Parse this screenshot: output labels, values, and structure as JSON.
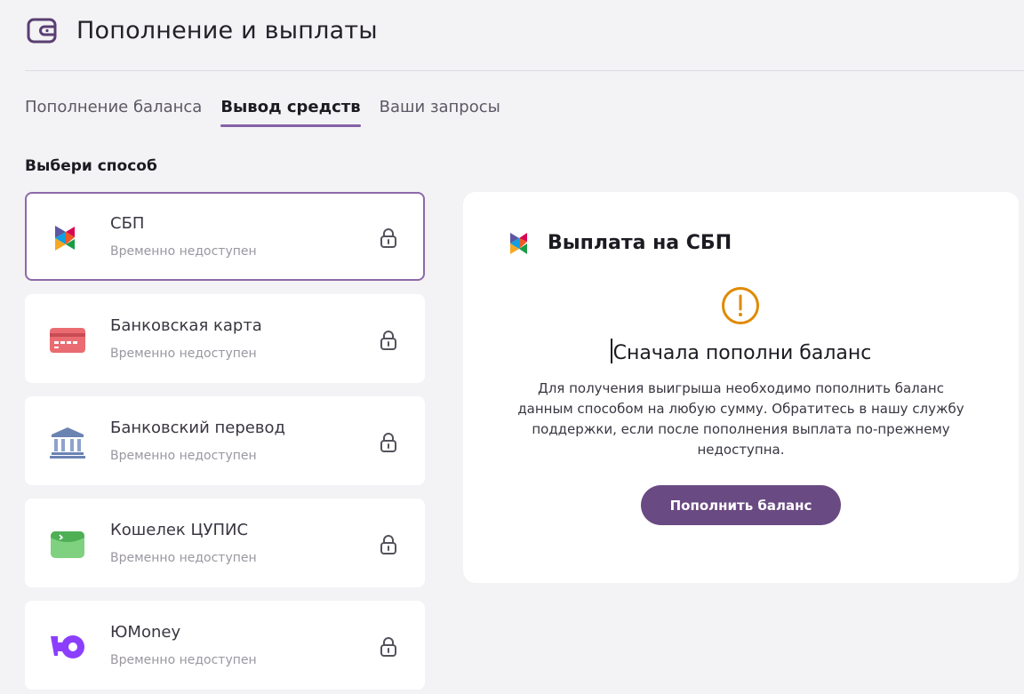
{
  "header": {
    "title": "Пополнение и выплаты",
    "icon": "wallet-icon"
  },
  "tabs": [
    {
      "label": "Пополнение баланса",
      "active": false
    },
    {
      "label": "Вывод средств",
      "active": true
    },
    {
      "label": "Ваши запросы",
      "active": false
    }
  ],
  "section_label": "Выбери способ",
  "methods": [
    {
      "name": "СБП",
      "status": "Временно недоступен",
      "icon": "sbp-logo-icon",
      "selected": true
    },
    {
      "name": "Банковская карта",
      "status": "Временно недоступен",
      "icon": "bank-card-icon",
      "selected": false
    },
    {
      "name": "Банковский перевод",
      "status": "Временно недоступен",
      "icon": "bank-building-icon",
      "selected": false
    },
    {
      "name": "Кошелек ЦУПИС",
      "status": "Временно недоступен",
      "icon": "cupis-wallet-icon",
      "selected": false
    },
    {
      "name": "ЮMoney",
      "status": "Временно недоступен",
      "icon": "yumoney-logo-icon",
      "selected": false
    }
  ],
  "panel": {
    "title": "Выплата на СБП",
    "notice_title": "Сначала пополни баланс",
    "notice_text": "Для получения выигрыша необходимо пополнить баланс данным способом на любую сумму. Обратитесь в нашу службу поддержки, если после пополнения выплата по-прежнему недоступна.",
    "button_label": "Пополнить баланс"
  },
  "colors": {
    "accent": "#8460a8",
    "button": "#6a4a82",
    "warning": "#e08a00",
    "background": "#f3f2f4"
  }
}
